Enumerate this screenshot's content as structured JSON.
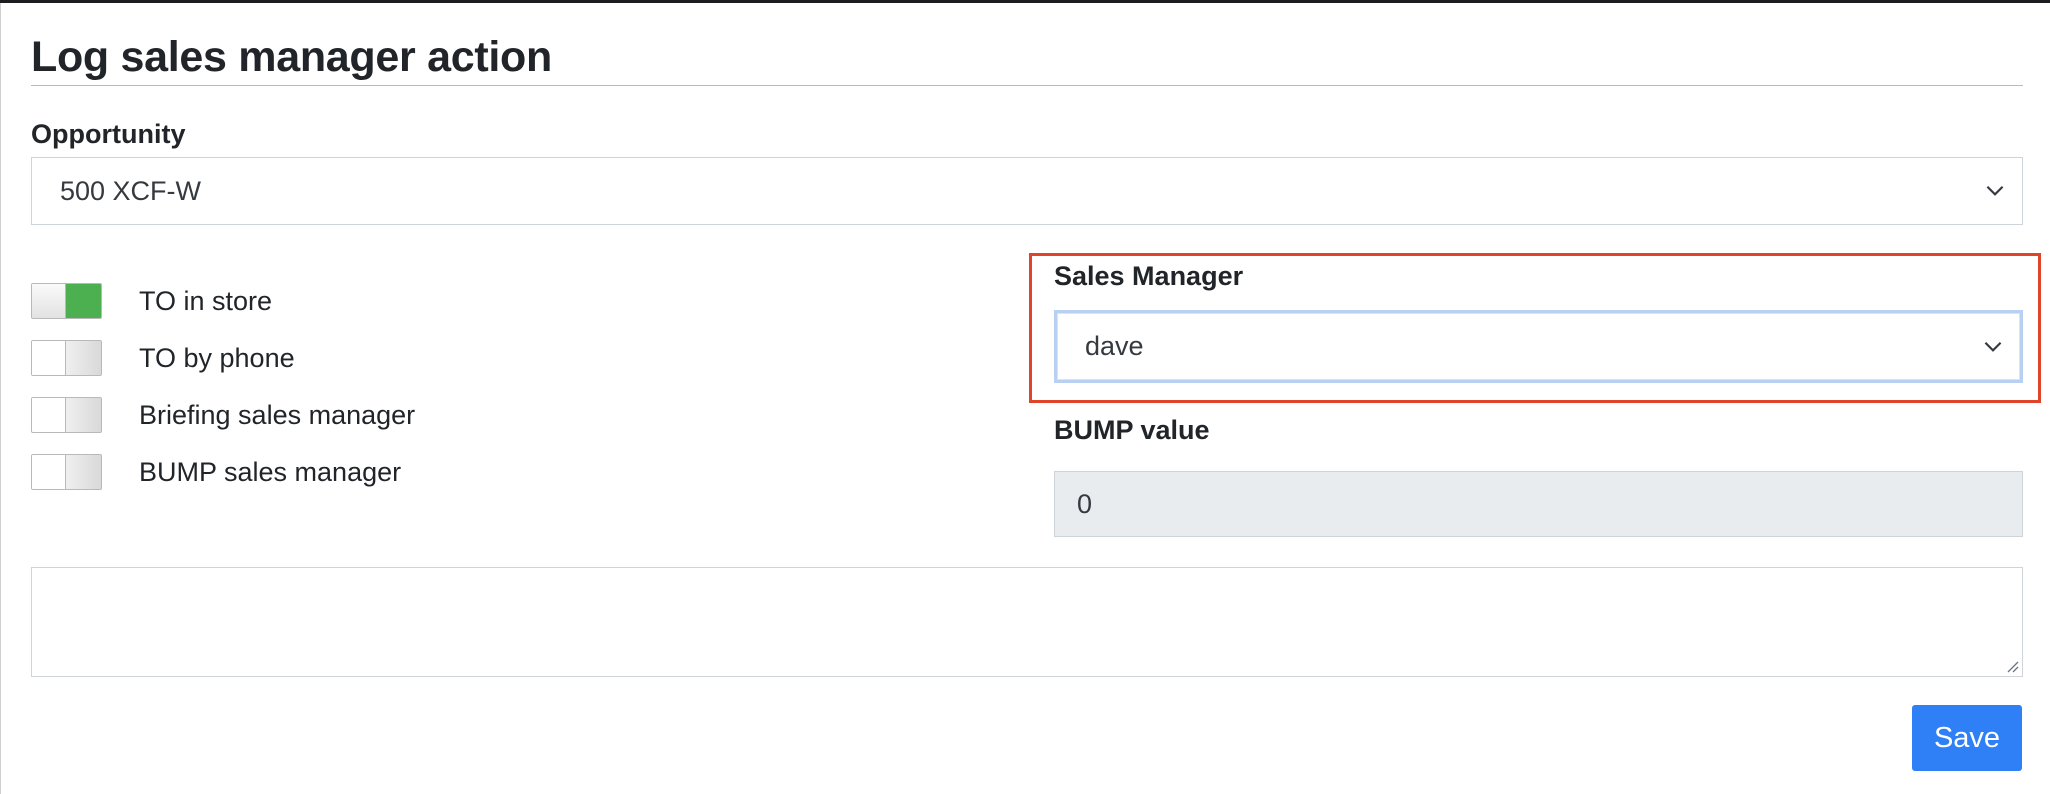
{
  "modal": {
    "title": "Log sales manager action"
  },
  "opportunity": {
    "label": "Opportunity",
    "selected": "500 XCF-W"
  },
  "toggles": [
    {
      "label": "TO in store",
      "on": true
    },
    {
      "label": "TO by phone",
      "on": false
    },
    {
      "label": "Briefing sales manager",
      "on": false
    },
    {
      "label": "BUMP sales manager",
      "on": false
    }
  ],
  "sales_manager": {
    "label": "Sales Manager",
    "selected": "dave"
  },
  "bump": {
    "label": "BUMP value",
    "value": "0"
  },
  "notes": {
    "value": ""
  },
  "actions": {
    "save_label": "Save"
  },
  "colors": {
    "accent": "#2f7ff7",
    "toggle_on": "#4caf50",
    "highlight": "#e0452b"
  },
  "icons": {
    "select_arrow": "chevron-down-icon",
    "textarea_resize": "resize-grip-icon"
  }
}
